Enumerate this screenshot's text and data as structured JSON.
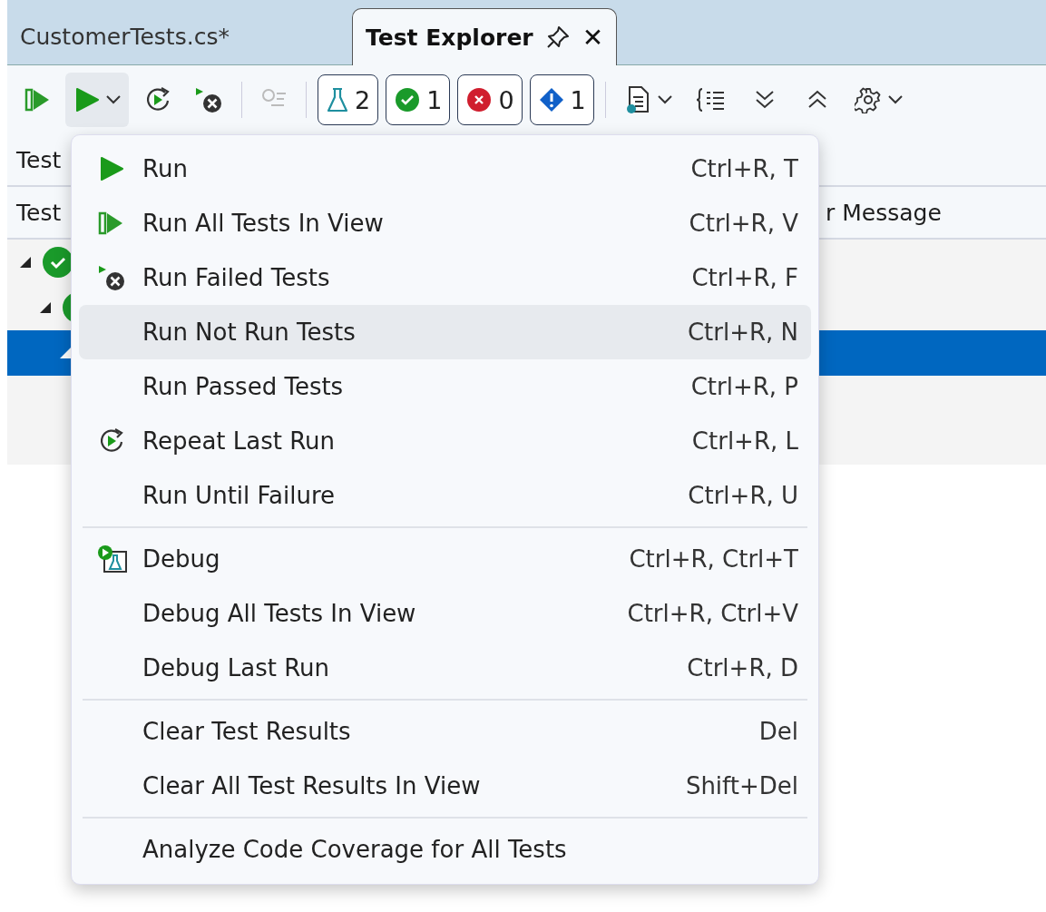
{
  "tabs": [
    {
      "label": "CustomerTests.cs*",
      "selected": false,
      "kind": "document"
    },
    {
      "label": "Test Explorer",
      "selected": true,
      "kind": "tool",
      "close": "✕"
    }
  ],
  "toolbar": [
    {
      "kind": "run-all"
    },
    {
      "kind": "run-split",
      "pressed": true
    },
    {
      "kind": "repeat"
    },
    {
      "kind": "run-failed"
    },
    {
      "kind": "separator"
    },
    {
      "kind": "disabled-filter"
    },
    {
      "kind": "separator"
    },
    {
      "kind": "tests",
      "count": "2"
    },
    {
      "kind": "passed",
      "count": "1"
    },
    {
      "kind": "failed",
      "count": "0"
    },
    {
      "kind": "info",
      "count": "1"
    },
    {
      "kind": "separator"
    },
    {
      "kind": "playlist"
    },
    {
      "kind": "group"
    },
    {
      "kind": "expand-all"
    },
    {
      "kind": "collapse-all"
    },
    {
      "kind": "settings"
    }
  ],
  "search_row": {
    "label": "Test"
  },
  "columns": [
    {
      "label": "Test"
    },
    {
      "label": "r Message"
    }
  ],
  "tree": [
    {
      "kind": "passed",
      "expanded": true,
      "selected": false,
      "children": [
        {
          "kind": "passed",
          "expanded": true,
          "selected": false,
          "children": [
            {
              "expanded": true,
              "selected": true
            }
          ]
        }
      ]
    }
  ],
  "menu": {
    "items": [
      {
        "kind": "run",
        "label": "Run",
        "shortcut": "Ctrl+R, T",
        "selected": false
      },
      {
        "kind": "runall",
        "label": "Run All Tests In View",
        "shortcut": "Ctrl+R, V",
        "selected": false
      },
      {
        "kind": "runfailed",
        "label": "Run Failed Tests",
        "shortcut": "Ctrl+R, F",
        "selected": false
      },
      {
        "kind": "item",
        "label": "Run Not Run Tests",
        "shortcut": "Ctrl+R, N",
        "selected": true
      },
      {
        "kind": "item",
        "label": "Run Passed Tests",
        "shortcut": "Ctrl+R, P",
        "selected": false
      },
      {
        "kind": "repeat",
        "label": "Repeat Last Run",
        "shortcut": "Ctrl+R, L",
        "selected": false
      },
      {
        "kind": "item",
        "label": "Run Until Failure",
        "shortcut": "Ctrl+R, U",
        "selected": false
      },
      {
        "kind": "separator"
      },
      {
        "kind": "debug",
        "label": "Debug",
        "shortcut": "Ctrl+R, Ctrl+T",
        "selected": false
      },
      {
        "kind": "item",
        "label": "Debug All Tests In View",
        "shortcut": "Ctrl+R, Ctrl+V",
        "selected": false
      },
      {
        "kind": "item",
        "label": "Debug Last Run",
        "shortcut": "Ctrl+R, D",
        "selected": false
      },
      {
        "kind": "separator"
      },
      {
        "kind": "item",
        "label": "Clear Test Results",
        "shortcut": "Del",
        "selected": false
      },
      {
        "kind": "item",
        "label": "Clear All Test Results In View",
        "shortcut": "Shift+Del",
        "selected": false
      },
      {
        "kind": "separator"
      },
      {
        "kind": "item",
        "label": "Analyze Code Coverage for All Tests",
        "selected": false
      }
    ]
  }
}
